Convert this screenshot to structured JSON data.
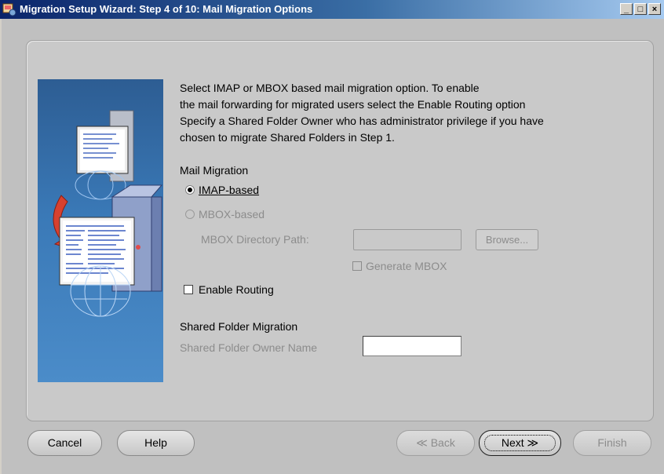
{
  "window": {
    "title": "Migration Setup Wizard:  Step 4 of 10: Mail Migration Options",
    "minimize_label": "_",
    "maximize_label": "□",
    "close_label": "×"
  },
  "description": [
    "Select IMAP or MBOX based mail migration option. To enable",
    "the mail forwarding for migrated users select the Enable Routing option",
    "Specify a Shared Folder Owner who has administrator privilege if you have",
    "chosen to migrate Shared Folders in Step 1."
  ],
  "mail_migration": {
    "heading": "Mail Migration",
    "imap_label": "IMAP-based",
    "imap_selected": true,
    "mbox_label": "MBOX-based",
    "mbox_selected": false,
    "mbox_dir_label": "MBOX Directory Path:",
    "mbox_dir_value": "",
    "browse_label": "Browse...",
    "generate_mbox_label": "Generate MBOX",
    "generate_mbox_checked": false
  },
  "routing": {
    "label": "Enable Routing",
    "checked": false
  },
  "shared_folder": {
    "heading": "Shared Folder Migration",
    "owner_label": "Shared Folder Owner Name",
    "owner_value": ""
  },
  "buttons": {
    "cancel": "Cancel",
    "help": "Help",
    "back": "Back",
    "next": "Next",
    "finish": "Finish"
  },
  "colors": {
    "title_bar_start": "#0a246a",
    "title_bar_end": "#a6caf0",
    "illustration_bg": "#3a79b7",
    "panel_bg": "#c9c9c9",
    "disabled_text": "#8c8c8c"
  }
}
